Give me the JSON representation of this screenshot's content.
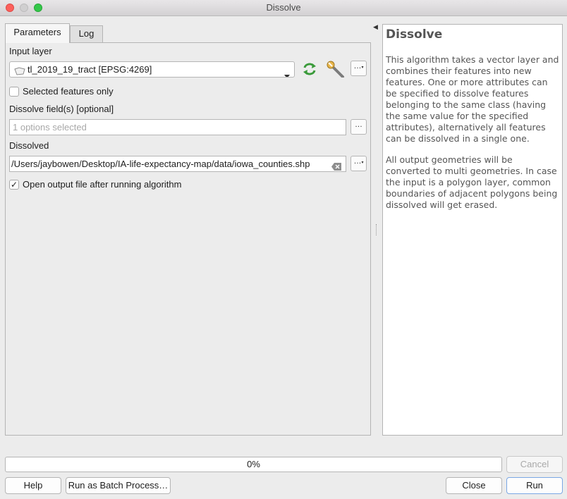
{
  "window": {
    "title": "Dissolve"
  },
  "tabs": [
    {
      "label": "Parameters"
    },
    {
      "label": "Log"
    }
  ],
  "parameters": {
    "input_layer": {
      "label": "Input layer",
      "value": "tl_2019_19_tract [EPSG:4269]"
    },
    "selected_only": {
      "label": "Selected features only",
      "checked": false
    },
    "dissolve_fields": {
      "label": "Dissolve field(s) [optional]",
      "placeholder": "1 options selected"
    },
    "dissolved": {
      "label": "Dissolved",
      "value": "/Users/jaybowen/Desktop/IA-life-expectancy-map/data/iowa_counties.shp"
    },
    "open_output": {
      "label": "Open output file after running algorithm",
      "checked": true
    },
    "dots_label": "…"
  },
  "help": {
    "title": "Dissolve",
    "paragraphs": [
      "This algorithm takes a vector layer and combines their features into new features. One or more attributes can be specified to dissolve features belonging to the same class (having the same value for the specified attributes), alternatively all features can be dissolved in a single one.",
      "All output geometries will be converted to multi geometries. In case the input is a polygon layer, common boundaries of adjacent polygons being dissolved will get erased."
    ]
  },
  "progress": {
    "value": 0,
    "label": "0%"
  },
  "buttons": {
    "cancel": "Cancel",
    "help": "Help",
    "batch": "Run as Batch Process…",
    "close": "Close",
    "run": "Run"
  },
  "colors": {
    "iterate_icon": "#3a9a3a",
    "accent": "#7aa7e4"
  }
}
